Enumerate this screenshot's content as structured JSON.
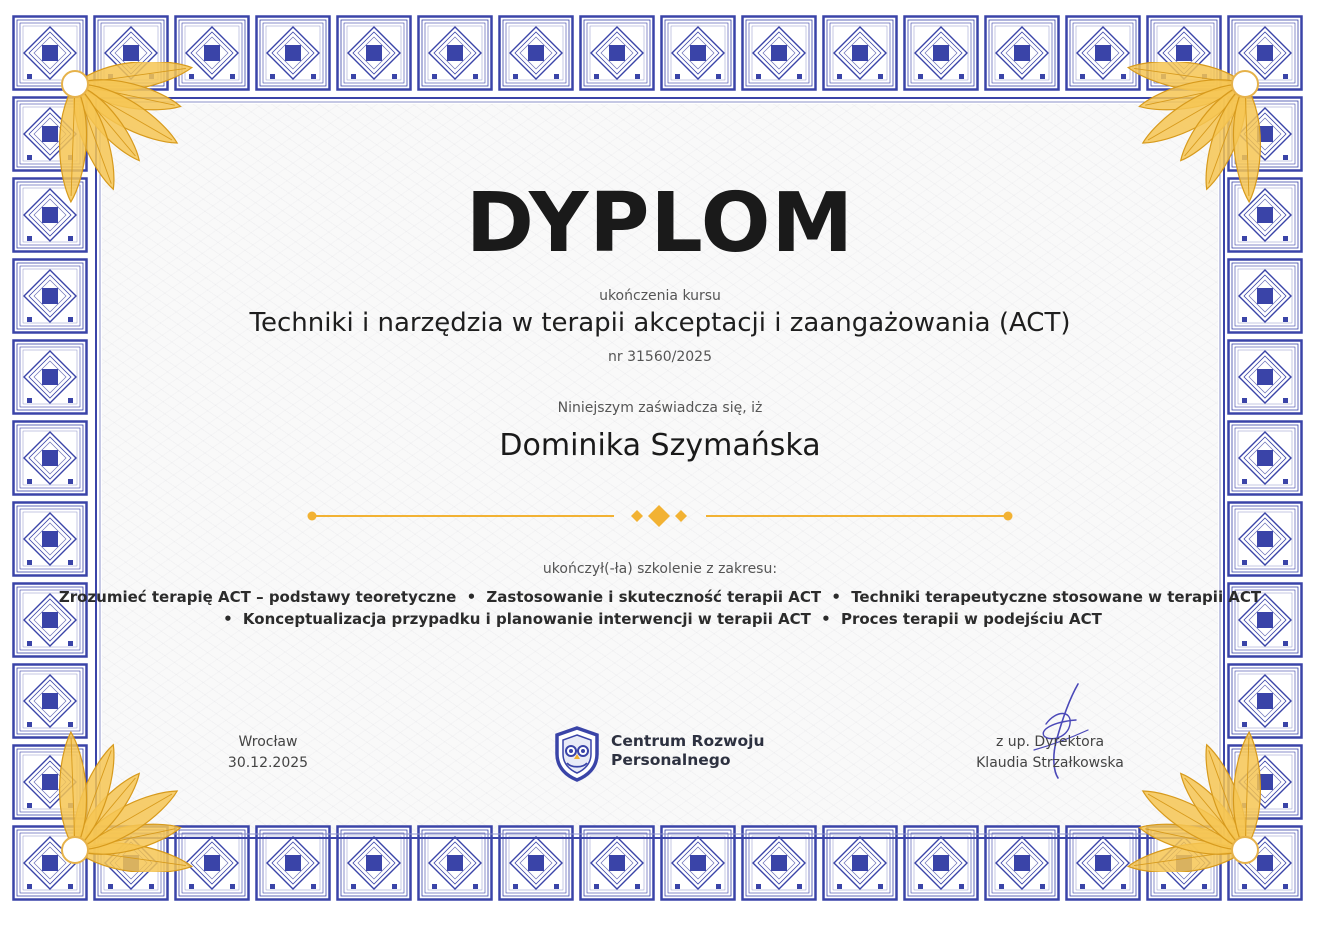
{
  "document": {
    "title": "DYPLOM",
    "subtitle": "ukończenia kursu",
    "course_name": "Techniki i narzędzia w terapii akceptacji i zaangażowania (ACT)",
    "course_number": "nr 31560/2025",
    "certify_text": "Niniejszym zaświadcza się, iż",
    "recipient": "Dominika Szymańska",
    "completed_text": "ukończył(-ła) szkolenie z zakresu:",
    "topics_line_1": [
      "Zrozumieć terapię ACT – podstawy teoretyczne",
      "Zastosowanie i skuteczność terapii ACT",
      "Techniki terapeutyczne stosowane w terapii ACT"
    ],
    "topics_line_2": [
      "Konceptualizacja przypadku i planowanie interwencji w terapii ACT",
      "Proces terapii w podejściu ACT"
    ],
    "bullet": "•",
    "place": "Wrocław",
    "date": "30.12.2025",
    "organization_line_1": "Centrum Rozwoju",
    "organization_line_2": "Personalnego",
    "signature_role": "z up. Dyrektora",
    "signature_name": "Klaudia Strzałkowska"
  },
  "colors": {
    "frame_blue": "#3a44a8",
    "frame_light": "#c9cde8",
    "gold": "#f2b233",
    "gold_dark": "#d79a1c",
    "text_dark": "#1a1a1a",
    "signature_ink": "#4a48b8"
  },
  "icons": {
    "logo": "owl-shield-icon",
    "corner": "golden-leaf-ornament",
    "divider": "diamond-divider"
  }
}
